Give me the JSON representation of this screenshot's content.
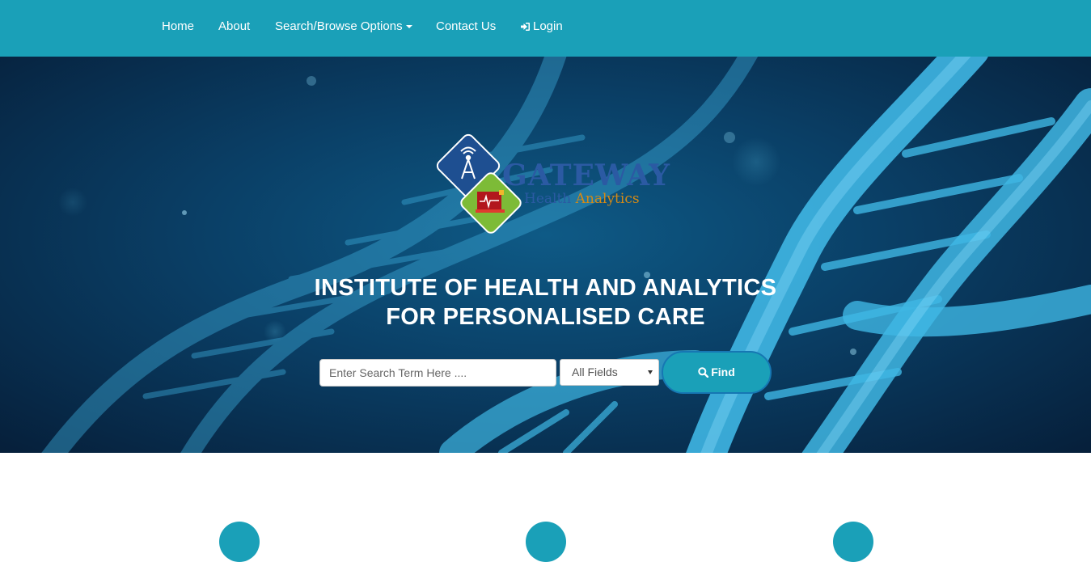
{
  "nav": {
    "home": "Home",
    "about": "About",
    "search_browse": "Search/Browse Options",
    "contact": "Contact Us",
    "login": "Login"
  },
  "logo": {
    "name": "GATEWAY",
    "sub_part1": "Health",
    "sub_part2": "Analytics"
  },
  "hero": {
    "title_line1": "INSTITUTE OF HEALTH AND ANALYTICS",
    "title_line2": "FOR PERSONALISED CARE"
  },
  "search": {
    "placeholder": "Enter Search Term Here ....",
    "field_select": "All Fields",
    "find_label": "Find"
  },
  "colors": {
    "nav_bg": "#1aa0b8",
    "accent": "#1aa0b8",
    "logo_blue": "#2b5aa3",
    "logo_orange": "#d38a16"
  },
  "icons": [
    "login-icon",
    "caret-down-icon",
    "search-icon",
    "tower-icon",
    "ecg-icon"
  ]
}
